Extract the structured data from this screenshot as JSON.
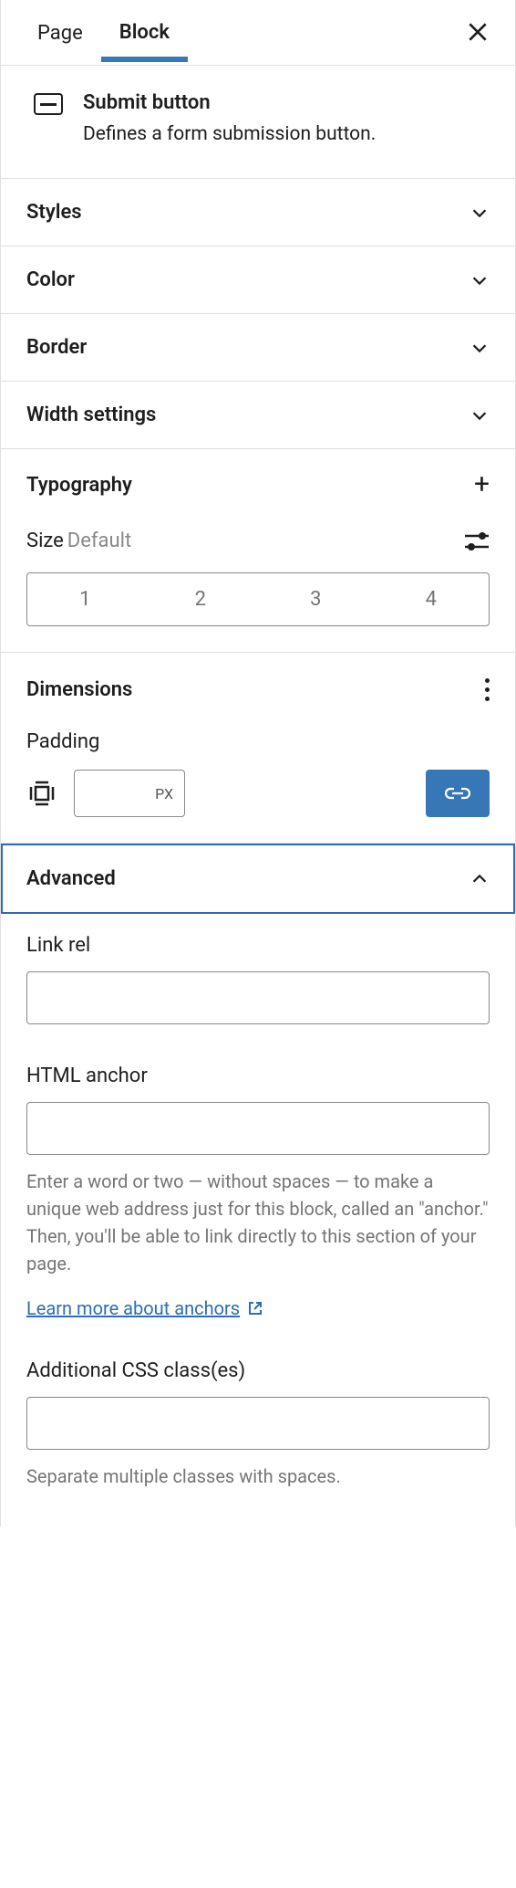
{
  "tabs": {
    "page": "Page",
    "block": "Block"
  },
  "block": {
    "title": "Submit button",
    "description": "Defines a form submission button."
  },
  "sections": {
    "styles": "Styles",
    "color": "Color",
    "border": "Border",
    "width": "Width settings",
    "typography": "Typography",
    "dimensions": "Dimensions",
    "advanced": "Advanced"
  },
  "typography": {
    "size_label": "Size",
    "size_value": "Default",
    "options": [
      "1",
      "2",
      "3",
      "4"
    ]
  },
  "dimensions": {
    "padding_label": "Padding",
    "unit": "PX"
  },
  "advanced": {
    "link_rel_label": "Link rel",
    "link_rel_value": "",
    "anchor_label": "HTML anchor",
    "anchor_value": "",
    "anchor_help": "Enter a word or two — without spaces — to make a unique web address just for this block, called an \"anchor.\" Then, you'll be able to link directly to this section of your page.",
    "anchor_link": "Learn more about anchors",
    "css_label": "Additional CSS class(es)",
    "css_value": "",
    "css_help": "Separate multiple classes with spaces."
  }
}
